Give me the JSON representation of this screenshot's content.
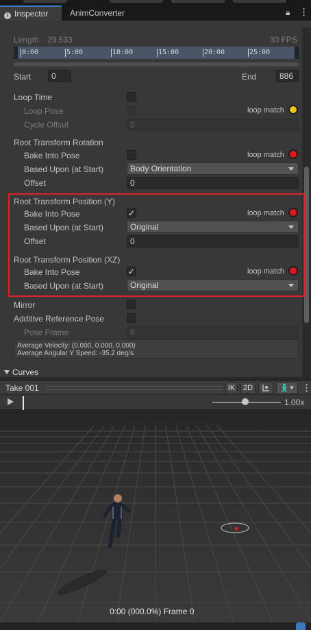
{
  "tabs": [
    {
      "label": "Inspector",
      "active": true
    },
    {
      "label": "AnimConverter",
      "active": false
    }
  ],
  "clip": {
    "length_label": "Length",
    "length_value": "29.533",
    "fps": "30 FPS",
    "ruler_ticks": [
      "0:00",
      "5:00",
      "10:00",
      "15:00",
      "20:00",
      "25:00"
    ],
    "start_label": "Start",
    "start_value": "0",
    "end_label": "End",
    "end_value": "886"
  },
  "loop": {
    "loop_time": "Loop Time",
    "loop_pose": "Loop Pose",
    "cycle_offset": "Cycle Offset",
    "cycle_offset_value": "0",
    "loop_match": "loop match"
  },
  "rotation": {
    "header": "Root Transform Rotation",
    "bake": "Bake Into Pose",
    "based_upon": "Based Upon (at Start)",
    "based_upon_value": "Body Orientation",
    "offset": "Offset",
    "offset_value": "0",
    "loop_match": "loop match"
  },
  "position_y": {
    "header": "Root Transform Position (Y)",
    "bake": "Bake Into Pose",
    "bake_checked": "✓",
    "based_upon": "Based Upon (at Start)",
    "based_upon_value": "Original",
    "offset": "Offset",
    "offset_value": "0",
    "loop_match": "loop match"
  },
  "position_xz": {
    "header": "Root Transform Position (XZ)",
    "bake": "Bake Into Pose",
    "bake_checked": "✓",
    "based_upon": "Based Upon (at Start)",
    "based_upon_value": "Original",
    "loop_match": "loop match"
  },
  "misc": {
    "mirror": "Mirror",
    "additive": "Additive Reference Pose",
    "pose_frame": "Pose Frame",
    "pose_frame_value": "0",
    "avg_velocity": "Average Velocity: (0.000, 0.000, 0.000)",
    "avg_angular": "Average Angular Y Speed: -35.2 deg/s",
    "curves": "Curves"
  },
  "preview": {
    "title": "Take 001",
    "ik": "IK",
    "twod": "2D",
    "speed": "1.00x",
    "frame_info": "0:00 (000.0%) Frame 0"
  },
  "colors": {
    "accent": "#3a79bb",
    "loop_red": "#e01818",
    "loop_yellow": "#f5c417",
    "highlight": "#e0202a"
  }
}
